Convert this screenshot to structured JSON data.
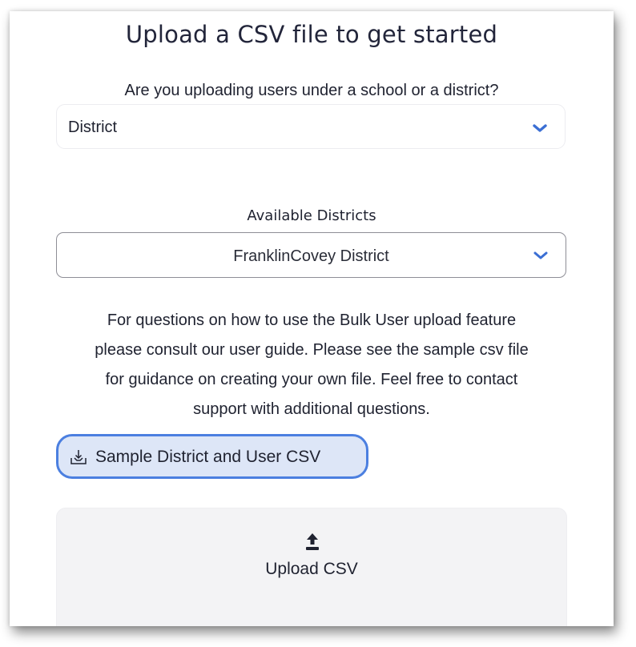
{
  "header": {
    "title": "Upload a CSV file to get started"
  },
  "scope": {
    "question": "Are you uploading users under a school or a district?",
    "selected": "District",
    "chevron_color": "#3b6fd4"
  },
  "districts": {
    "label": "Available Districts",
    "selected": "FranklinCovey District",
    "chevron_color": "#3b6fd4"
  },
  "info": {
    "line1": "For questions on how to use the Bulk User upload feature",
    "line2": "please consult our user guide. Please see the sample csv file",
    "line3": "for guidance on creating your own file. Feel free to contact",
    "line4": "support with additional questions."
  },
  "sample_button": {
    "label": "Sample District and User CSV",
    "icon": "download-tray-icon",
    "accent": "#4b7fe0"
  },
  "upload": {
    "label": "Upload CSV",
    "icon": "upload-arrow-icon"
  }
}
